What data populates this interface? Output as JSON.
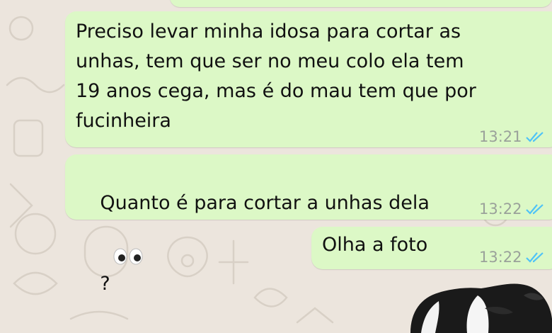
{
  "messages": [
    {
      "lines": [
        "Preciso levar minha idosa para cortar as",
        "unhas, tem que ser no meu colo ela tem",
        "19 anos cega, mas é do mau tem que por",
        "fucinheira"
      ],
      "time": "13:21"
    },
    {
      "text": "Quanto é para cortar a unhas dela",
      "emoji": "👀",
      "after": "?",
      "time": "13:22"
    },
    {
      "text": "Olha a foto",
      "time": "13:22"
    }
  ],
  "colors": {
    "bubble": "#dcf8c6",
    "background": "#ece5dd",
    "read_ticks": "#4fc3f7",
    "time": "#9aa19a"
  },
  "icons": [
    "double-check-read-icon",
    "eyes-emoji",
    "dog-photo"
  ]
}
